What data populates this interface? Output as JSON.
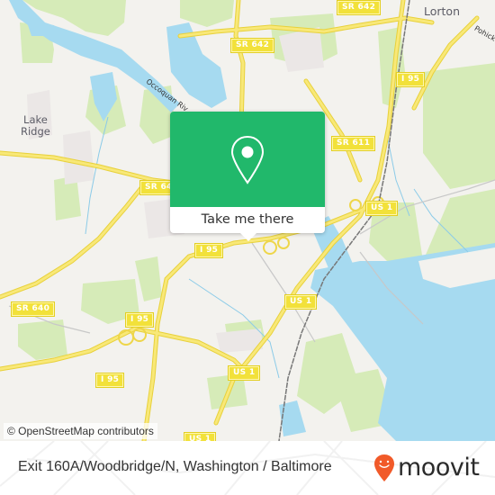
{
  "map": {
    "attribution": "© OpenStreetMap contributors",
    "places": {
      "lake_ridge_line1": "Lake",
      "lake_ridge_line2": "Ridge",
      "lorton": "Lorton",
      "pohick": "Pohick",
      "occoquan_river": "Occoquan Riv"
    },
    "road_shields": {
      "sr642_top": "SR 642",
      "sr642_mid": "SR 642",
      "sr611": "SR 611",
      "sr640_center": "SR 64",
      "sr640_left": "SR 640",
      "i95_lorton": "I 95",
      "i95_center": "I 95",
      "i95_interchange": "I 95",
      "i95_lower": "I 95",
      "us1_east": "US 1",
      "us1_center": "US 1",
      "us1_lower": "US 1",
      "us1_bottom": "US 1"
    },
    "colors": {
      "land": "#f3f2ee",
      "water": "#a6daf0",
      "park": "#d6ebb8",
      "road": "#f4e05c",
      "rail": "#777777"
    }
  },
  "popup": {
    "icon": "map-pin-icon",
    "action_label": "Take me there",
    "color": "#21b86b"
  },
  "footer": {
    "title": "Exit 160A/Woodbridge/N, Washington / Baltimore",
    "logo_text": "moovit",
    "logo_icon": "moovit-pin-smiley-icon",
    "logo_color": "#f15a29"
  }
}
